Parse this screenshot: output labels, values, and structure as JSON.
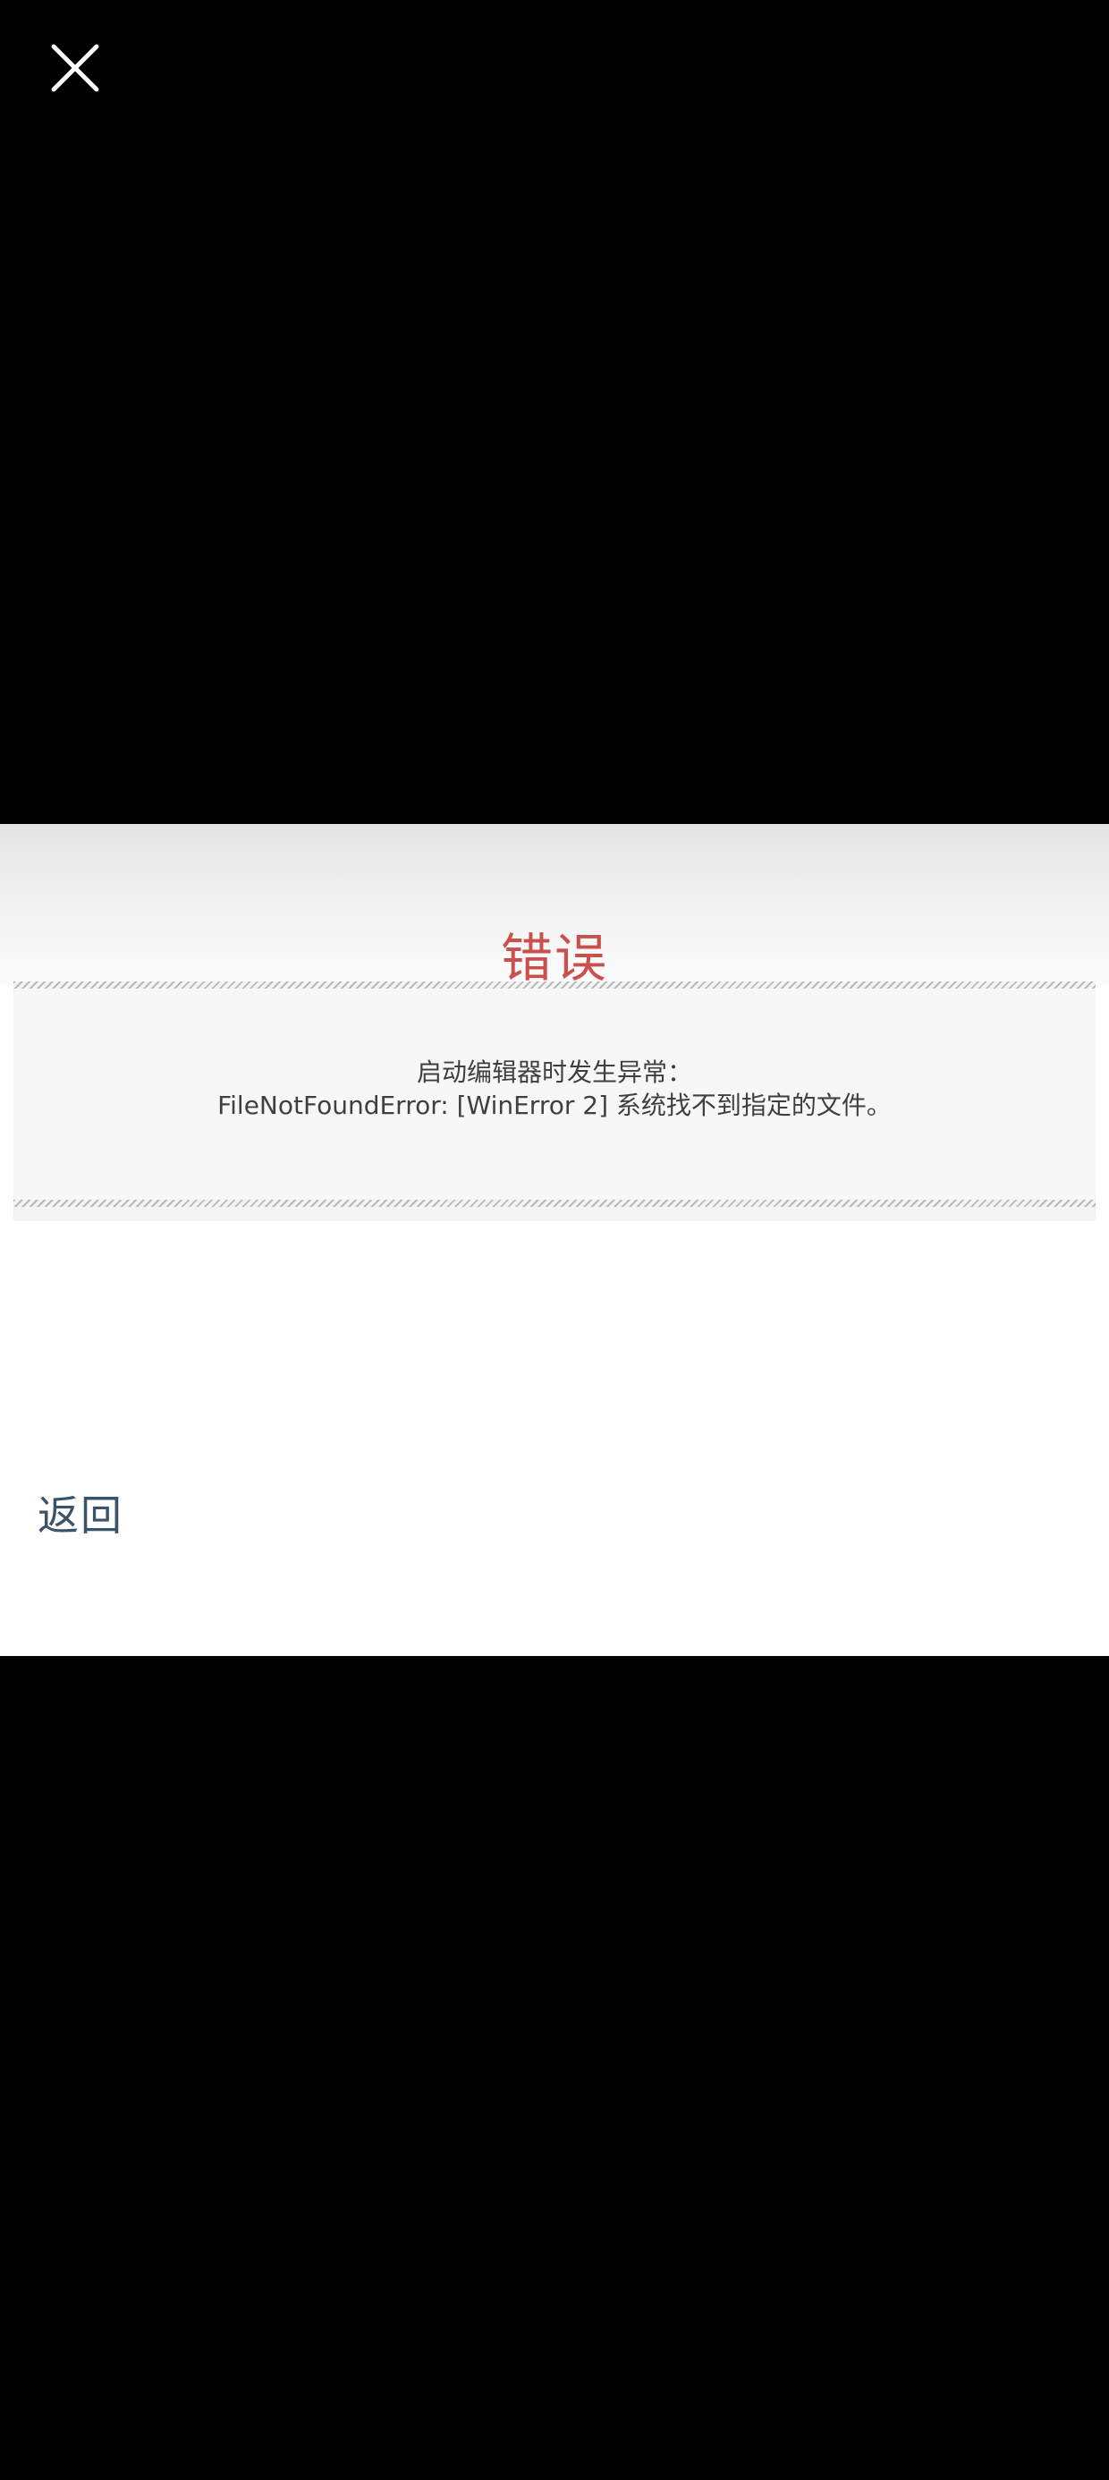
{
  "viewer": {
    "close_icon": "close-icon",
    "background_color": "#000000"
  },
  "error_page": {
    "title": "错误",
    "title_color": "#c9504d",
    "message_lines": [
      "启动编辑器时发生异常：",
      "FileNotFoundError: [WinError 2] 系统找不到指定的文件。"
    ],
    "back_label": "返回",
    "back_color": "#3a5368"
  }
}
